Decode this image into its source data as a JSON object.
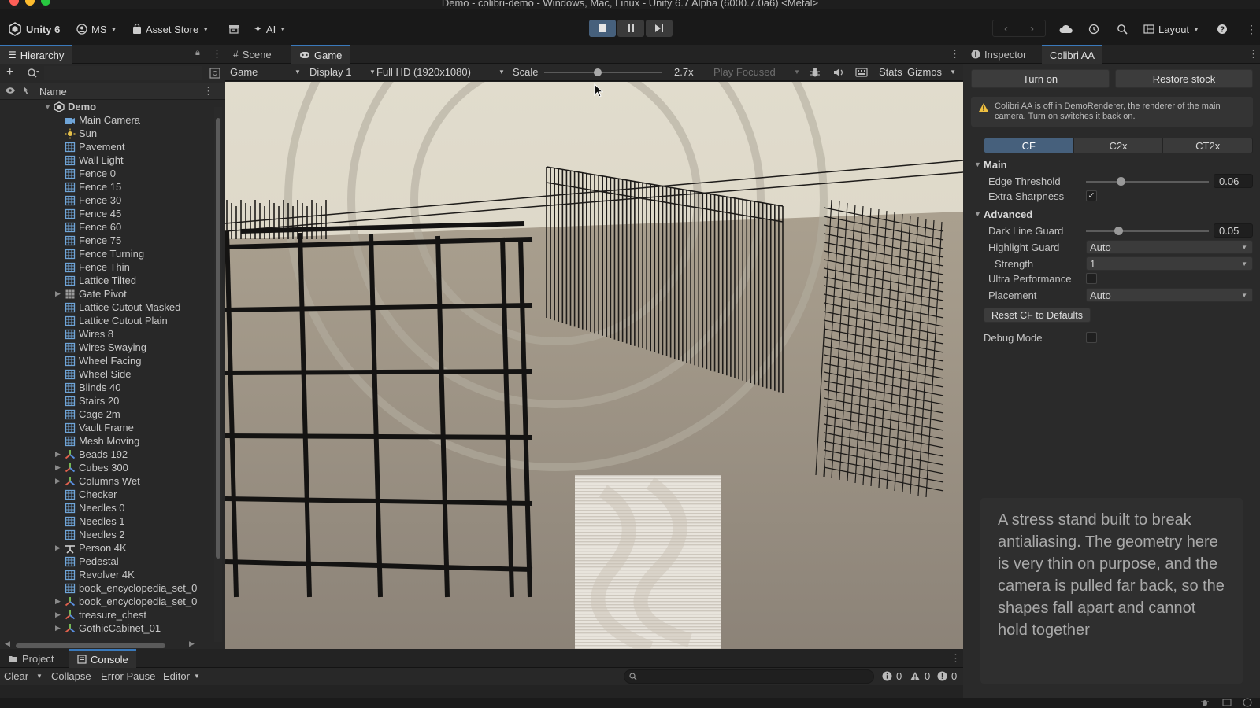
{
  "window": {
    "title": "Demo - colibri-demo - Windows, Mac, Linux - Unity 6.7 Alpha (6000.7.0a6) <Metal>"
  },
  "toolbar": {
    "unity_label": "Unity 6",
    "account_label": "MS",
    "asset_store_label": "Asset Store",
    "ai_label": "AI",
    "layout_label": "Layout"
  },
  "hierarchy": {
    "tab_label": "Hierarchy",
    "column_name": "Name",
    "items": [
      {
        "label": "Demo",
        "depth": 0,
        "icon": "scene",
        "expandable": true,
        "expanded": true
      },
      {
        "label": "Main Camera",
        "depth": 1,
        "icon": "camera"
      },
      {
        "label": "Sun",
        "depth": 1,
        "icon": "light"
      },
      {
        "label": "Pavement",
        "depth": 1,
        "icon": "prefab"
      },
      {
        "label": "Wall Light",
        "depth": 1,
        "icon": "prefab"
      },
      {
        "label": "Fence 0",
        "depth": 1,
        "icon": "prefab"
      },
      {
        "label": "Fence 15",
        "depth": 1,
        "icon": "prefab"
      },
      {
        "label": "Fence 30",
        "depth": 1,
        "icon": "prefab"
      },
      {
        "label": "Fence 45",
        "depth": 1,
        "icon": "prefab"
      },
      {
        "label": "Fence 60",
        "depth": 1,
        "icon": "prefab"
      },
      {
        "label": "Fence 75",
        "depth": 1,
        "icon": "prefab"
      },
      {
        "label": "Fence Turning",
        "depth": 1,
        "icon": "prefab"
      },
      {
        "label": "Fence Thin",
        "depth": 1,
        "icon": "prefab"
      },
      {
        "label": "Lattice Tilted",
        "depth": 1,
        "icon": "prefab"
      },
      {
        "label": "Gate Pivot",
        "depth": 1,
        "icon": "gameobject",
        "expandable": true
      },
      {
        "label": "Lattice Cutout Masked",
        "depth": 1,
        "icon": "prefab"
      },
      {
        "label": "Lattice Cutout Plain",
        "depth": 1,
        "icon": "prefab"
      },
      {
        "label": "Wires 8",
        "depth": 1,
        "icon": "prefab"
      },
      {
        "label": "Wires Swaying",
        "depth": 1,
        "icon": "prefab"
      },
      {
        "label": "Wheel Facing",
        "depth": 1,
        "icon": "prefab"
      },
      {
        "label": "Wheel Side",
        "depth": 1,
        "icon": "prefab"
      },
      {
        "label": "Blinds 40",
        "depth": 1,
        "icon": "prefab"
      },
      {
        "label": "Stairs 20",
        "depth": 1,
        "icon": "prefab"
      },
      {
        "label": "Cage 2m",
        "depth": 1,
        "icon": "prefab"
      },
      {
        "label": "Vault Frame",
        "depth": 1,
        "icon": "prefab"
      },
      {
        "label": "Mesh Moving",
        "depth": 1,
        "icon": "prefab"
      },
      {
        "label": "Beads 192",
        "depth": 1,
        "icon": "transform",
        "expandable": true
      },
      {
        "label": "Cubes 300",
        "depth": 1,
        "icon": "transform",
        "expandable": true
      },
      {
        "label": "Columns Wet",
        "depth": 1,
        "icon": "transform",
        "expandable": true
      },
      {
        "label": "Checker",
        "depth": 1,
        "icon": "prefab"
      },
      {
        "label": "Needles 0",
        "depth": 1,
        "icon": "prefab"
      },
      {
        "label": "Needles 1",
        "depth": 1,
        "icon": "prefab"
      },
      {
        "label": "Needles 2",
        "depth": 1,
        "icon": "prefab"
      },
      {
        "label": "Person 4K",
        "depth": 1,
        "icon": "person",
        "expandable": true
      },
      {
        "label": "Pedestal",
        "depth": 1,
        "icon": "prefab"
      },
      {
        "label": "Revolver 4K",
        "depth": 1,
        "icon": "prefab"
      },
      {
        "label": "book_encyclopedia_set_0",
        "depth": 1,
        "icon": "prefab"
      },
      {
        "label": "book_encyclopedia_set_0",
        "depth": 1,
        "icon": "transform",
        "expandable": true
      },
      {
        "label": "treasure_chest",
        "depth": 1,
        "icon": "transform",
        "expandable": true
      },
      {
        "label": "GothicCabinet_01",
        "depth": 1,
        "icon": "transform",
        "expandable": true
      }
    ]
  },
  "game_view": {
    "tabs": [
      {
        "label": "Scene",
        "active": false
      },
      {
        "label": "Game",
        "active": true
      }
    ],
    "mode_label": "Game",
    "display_label": "Display 1",
    "resolution_label": "Full HD (1920x1080)",
    "scale_label": "Scale",
    "scale_value": "2.7x",
    "scale_fraction": 0.45,
    "play_focused_label": "Play Focused",
    "stats_label": "Stats",
    "gizmos_label": "Gizmos"
  },
  "inspector": {
    "tabs": [
      {
        "label": "Inspector",
        "active": false
      },
      {
        "label": "Colibri AA",
        "active": true
      }
    ],
    "turn_on_label": "Turn on",
    "restore_label": "Restore stock",
    "warning_text": "Colibri AA is off in DemoRenderer, the renderer of the main camera. Turn on switches it back on.",
    "modes": [
      {
        "label": "CF",
        "selected": true
      },
      {
        "label": "C2x",
        "selected": false
      },
      {
        "label": "CT2x",
        "selected": false
      }
    ],
    "main_section": "Main",
    "edge_threshold_label": "Edge Threshold",
    "edge_threshold_value": "0.06",
    "edge_threshold_fraction": 0.28,
    "extra_sharpness_label": "Extra Sharpness",
    "extra_sharpness_checked": true,
    "advanced_section": "Advanced",
    "dark_line_guard_label": "Dark Line Guard",
    "dark_line_guard_value": "0.05",
    "dark_line_guard_fraction": 0.26,
    "highlight_guard_label": "Highlight Guard",
    "highlight_guard_value": "Auto",
    "strength_label": "Strength",
    "strength_value": "1",
    "ultra_performance_label": "Ultra Performance",
    "ultra_performance_checked": false,
    "placement_label": "Placement",
    "placement_value": "Auto",
    "reset_label": "Reset CF to Defaults",
    "debug_mode_label": "Debug Mode",
    "debug_mode_checked": false,
    "note_text": "A stress stand built to break antialiasing. The geometry here is very thin on purpose, and the camera is pulled far back, so the shapes fall apart and cannot hold together"
  },
  "console": {
    "tabs": [
      {
        "label": "Project",
        "active": false
      },
      {
        "label": "Console",
        "active": true
      }
    ],
    "clear_label": "Clear",
    "collapse_label": "Collapse",
    "error_pause_label": "Error Pause",
    "editor_label": "Editor",
    "log_count": "0",
    "warning_count": "0",
    "error_count": "0"
  },
  "colors": {
    "accent": "#3a79bb",
    "selected_button": "#46607c",
    "warning": "#f0c040",
    "prefab_icon": "#6fa5d8"
  }
}
